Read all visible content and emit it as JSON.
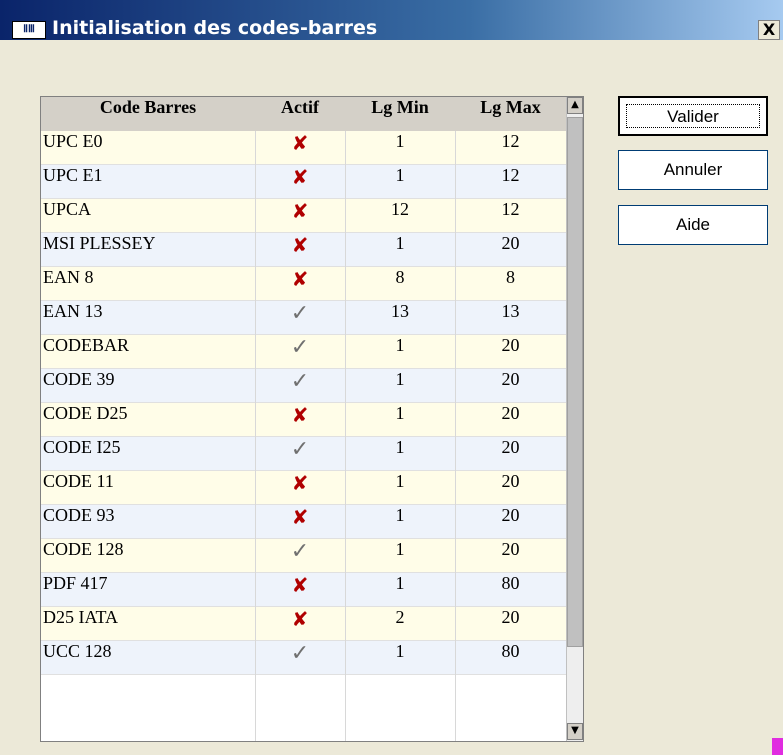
{
  "window": {
    "title": "Initialisation des codes-barres",
    "icon": "app-icon",
    "close_label": "X"
  },
  "table": {
    "columns": [
      "Code Barres",
      "Actif",
      "Lg Min",
      "Lg Max"
    ],
    "rows": [
      {
        "name": "UPC E0",
        "active": false,
        "min": "1",
        "max": "12"
      },
      {
        "name": "UPC E1",
        "active": false,
        "min": "1",
        "max": "12"
      },
      {
        "name": "UPCA",
        "active": false,
        "min": "12",
        "max": "12"
      },
      {
        "name": "MSI PLESSEY",
        "active": false,
        "min": "1",
        "max": "20"
      },
      {
        "name": "EAN 8",
        "active": false,
        "min": "8",
        "max": "8"
      },
      {
        "name": "EAN 13",
        "active": true,
        "min": "13",
        "max": "13"
      },
      {
        "name": "CODEBAR",
        "active": true,
        "min": "1",
        "max": "20"
      },
      {
        "name": "CODE 39",
        "active": true,
        "min": "1",
        "max": "20"
      },
      {
        "name": "CODE D25",
        "active": false,
        "min": "1",
        "max": "20"
      },
      {
        "name": "CODE I25",
        "active": true,
        "min": "1",
        "max": "20"
      },
      {
        "name": "CODE 11",
        "active": false,
        "min": "1",
        "max": "20"
      },
      {
        "name": "CODE 93",
        "active": false,
        "min": "1",
        "max": "20"
      },
      {
        "name": "CODE 128",
        "active": true,
        "min": "1",
        "max": "20"
      },
      {
        "name": "PDF 417",
        "active": false,
        "min": "1",
        "max": "80"
      },
      {
        "name": "D25 IATA",
        "active": false,
        "min": "2",
        "max": "20"
      },
      {
        "name": "UCC 128",
        "active": true,
        "min": "1",
        "max": "80"
      }
    ],
    "icons": {
      "active": "check-icon",
      "inactive": "cross-icon"
    }
  },
  "buttons": {
    "validate": "Valider",
    "cancel": "Annuler",
    "help": "Aide"
  },
  "colors": {
    "titlebar_start": "#0a246a",
    "titlebar_end": "#a6caf0",
    "cross": "#b00000",
    "check": "#707070",
    "row_odd": "#fffde8",
    "row_even": "#eef3fb"
  }
}
